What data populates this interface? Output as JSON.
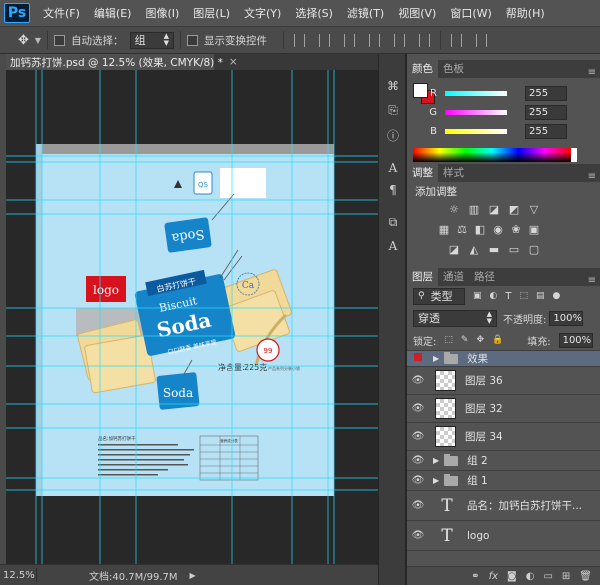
{
  "app": {
    "logo": "Ps"
  },
  "menu": {
    "items": [
      "文件(F)",
      "编辑(E)",
      "图像(I)",
      "图层(L)",
      "文字(Y)",
      "选择(S)",
      "滤镜(T)",
      "视图(V)",
      "窗口(W)",
      "帮助(H)"
    ]
  },
  "window_controls": {
    "minimize": "—",
    "maximize": "□",
    "close": "✕"
  },
  "options": {
    "auto_select_label": "自动选择：",
    "auto_select_value": "组",
    "show_transform_label": "显示变换控件"
  },
  "document": {
    "tab_title": "加钙苏打饼.psd @ 12.5% (效果, CMYK/8) *",
    "close": "×"
  },
  "status": {
    "zoom": "12.5%",
    "doc_info": "文档:40.7M/99.7M"
  },
  "artwork": {
    "logo_text": "logo",
    "tag_top_brand": "白苏打饼干",
    "tag_main_biscuit": "Biscuit",
    "tag_main_soda": "Soda",
    "tag_main_sub": "口口酥香  美味享受",
    "tag_small_top": "Soda",
    "tag_small_bottom": "Soda",
    "ca_text": "Ca",
    "net_weight_label": "净含量:",
    "net_weight_value": "225克",
    "net_weight_note": "产品系列分装小袋",
    "qs_text": "QS",
    "seal_text": "99",
    "ingredients_title": "品名:加钙苏打饼干",
    "nutrition_title": "营养成分表"
  },
  "color_panel": {
    "tabs": [
      "颜色",
      "色板"
    ],
    "sliders": [
      {
        "label": "R",
        "value": "255"
      },
      {
        "label": "G",
        "value": "255"
      },
      {
        "label": "B",
        "value": "255"
      }
    ],
    "fg_color": "#ffffff",
    "bg_color": "#d7121c"
  },
  "adjust_panel": {
    "tabs": [
      "调整",
      "样式"
    ],
    "title": "添加调整"
  },
  "layers_panel": {
    "tabs": [
      "图层",
      "通道",
      "路径"
    ],
    "filter_value": "类型",
    "blend_mode": "穿透",
    "opacity_label": "不透明度:",
    "opacity_value": "100%",
    "lock_label": "锁定:",
    "fill_label": "填充:",
    "fill_value": "100%",
    "layers": [
      {
        "name": "效果",
        "kind": "group"
      },
      {
        "name": "图层 36",
        "kind": "pixel"
      },
      {
        "name": "图层 32",
        "kind": "pixel"
      },
      {
        "name": "图层 34",
        "kind": "pixel"
      },
      {
        "name": "组 2",
        "kind": "group"
      },
      {
        "name": "组 1",
        "kind": "group"
      },
      {
        "name": "品名：加钙白苏打饼干...",
        "kind": "text"
      },
      {
        "name": "logo",
        "kind": "text"
      }
    ]
  }
}
